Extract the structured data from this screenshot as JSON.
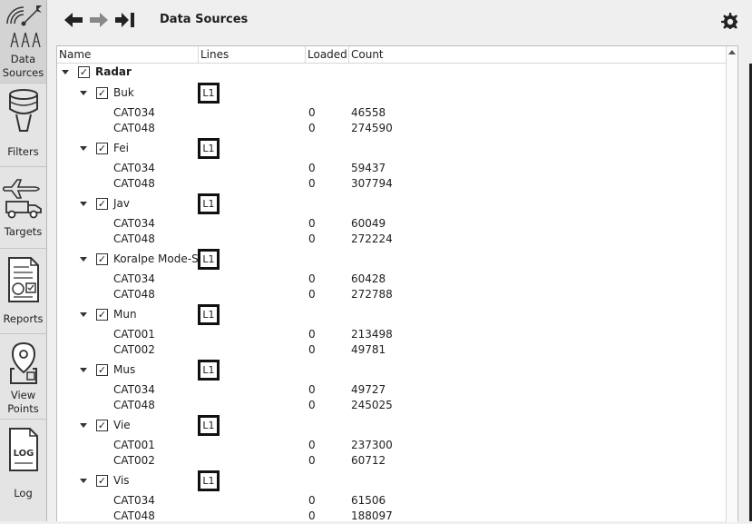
{
  "sidebar": {
    "items": [
      {
        "label": "Data\nSources",
        "icon": "radar-tower-icon",
        "active": true
      },
      {
        "label": "Filters",
        "icon": "funnel-icon"
      },
      {
        "label": "Targets",
        "icon": "plane-truck-icon"
      },
      {
        "label": "Reports",
        "icon": "report-document-icon"
      },
      {
        "label": "View\nPoints",
        "icon": "location-pin-icon"
      },
      {
        "label": "Log",
        "icon": "log-document-icon"
      }
    ]
  },
  "toolbar": {
    "title": "Data Sources",
    "back_icon": "arrow-left-icon",
    "forward_icon": "arrow-right-icon",
    "last_icon": "arrow-to-end-icon",
    "settings_icon": "gear-icon"
  },
  "table": {
    "headers": [
      "Name",
      "Lines",
      "Loaded",
      "Count"
    ],
    "root": {
      "label": "Radar",
      "checked": true
    },
    "sources": [
      {
        "name": "Buk",
        "line": "L1",
        "cats": [
          {
            "cat": "CAT034",
            "loaded": "0",
            "count": "46558"
          },
          {
            "cat": "CAT048",
            "loaded": "0",
            "count": "274590"
          }
        ]
      },
      {
        "name": "Fei",
        "line": "L1",
        "cats": [
          {
            "cat": "CAT034",
            "loaded": "0",
            "count": "59437"
          },
          {
            "cat": "CAT048",
            "loaded": "0",
            "count": "307794"
          }
        ]
      },
      {
        "name": "Jav",
        "line": "L1",
        "cats": [
          {
            "cat": "CAT034",
            "loaded": "0",
            "count": "60049"
          },
          {
            "cat": "CAT048",
            "loaded": "0",
            "count": "272224"
          }
        ]
      },
      {
        "name": "Koralpe Mode-S",
        "line": "L1",
        "cats": [
          {
            "cat": "CAT034",
            "loaded": "0",
            "count": "60428"
          },
          {
            "cat": "CAT048",
            "loaded": "0",
            "count": "272788"
          }
        ]
      },
      {
        "name": "Mun",
        "line": "L1",
        "cats": [
          {
            "cat": "CAT001",
            "loaded": "0",
            "count": "213498"
          },
          {
            "cat": "CAT002",
            "loaded": "0",
            "count": "49781"
          }
        ]
      },
      {
        "name": "Mus",
        "line": "L1",
        "cats": [
          {
            "cat": "CAT034",
            "loaded": "0",
            "count": "49727"
          },
          {
            "cat": "CAT048",
            "loaded": "0",
            "count": "245025"
          }
        ]
      },
      {
        "name": "Vie",
        "line": "L1",
        "cats": [
          {
            "cat": "CAT001",
            "loaded": "0",
            "count": "237300"
          },
          {
            "cat": "CAT002",
            "loaded": "0",
            "count": "60712"
          }
        ]
      },
      {
        "name": "Vis",
        "line": "L1",
        "cats": [
          {
            "cat": "CAT034",
            "loaded": "0",
            "count": "61506"
          },
          {
            "cat": "CAT048",
            "loaded": "0",
            "count": "188097"
          }
        ]
      }
    ]
  }
}
